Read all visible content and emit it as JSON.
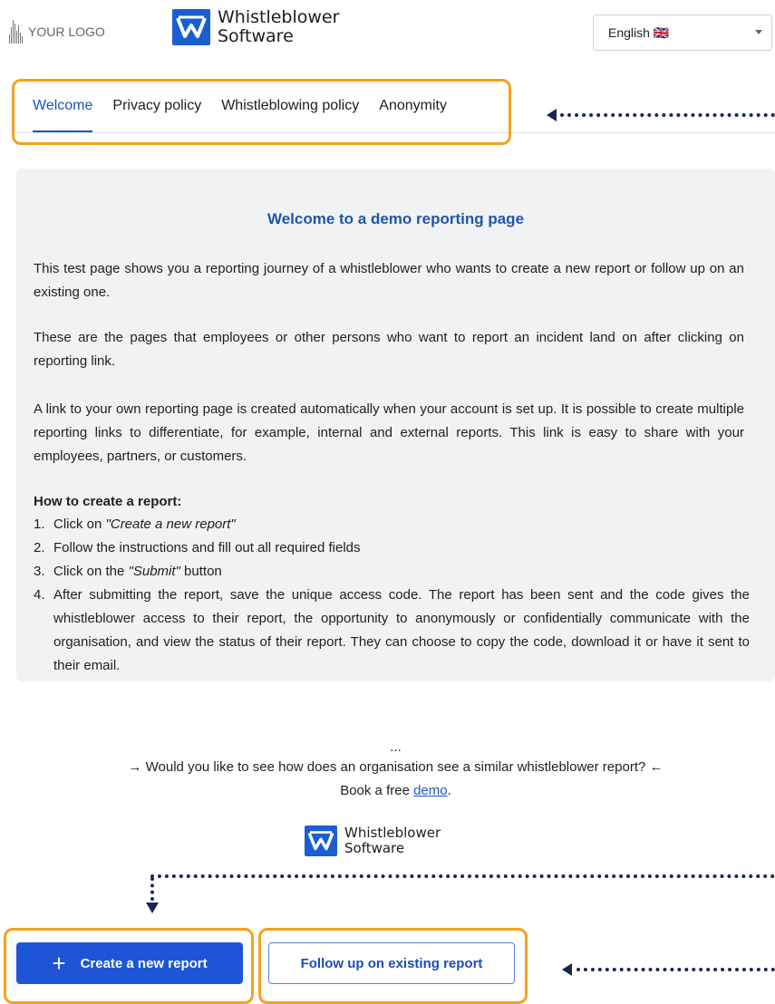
{
  "header": {
    "your_logo": "YOUR LOGO",
    "brand_line1": "Whistleblower",
    "brand_line2": "Software",
    "language": "English 🇬🇧"
  },
  "tabs": [
    {
      "label": "Welcome",
      "active": true
    },
    {
      "label": "Privacy policy"
    },
    {
      "label": "Whistleblowing policy"
    },
    {
      "label": "Anonymity"
    }
  ],
  "content": {
    "title": "Welcome to a demo reporting page",
    "paragraphs": [
      "This test page shows you a reporting journey of a whistleblower who wants to create a new report or follow up on an existing one.",
      "These are the pages that employees or other persons who want to report an incident land on after clicking on reporting link.",
      "A link to your own reporting page is created automatically when your account is set up. It is possible to create multiple reporting links to differentiate, for example, internal and external reports. This link is easy to share with your employees, partners, or customers."
    ],
    "howto_heading": "How to create a report:",
    "steps": [
      {
        "num": "1.",
        "pre": "Click on ",
        "em": "\"Create a new report\"",
        "post": ""
      },
      {
        "num": "2.",
        "pre": "Follow the instructions and fill out all required fields",
        "em": "",
        "post": ""
      },
      {
        "num": "3.",
        "pre": "Click on the ",
        "em": "\"Submit\"",
        "post": " button"
      },
      {
        "num": "4.",
        "pre": "After submitting the report, save the unique access code. The report has been sent and the code gives the whistleblower access to their report, the opportunity to anonymously or confidentially communicate with the organisation, and view the status of their report. They can choose to copy the code, download it or have it sent to their email.",
        "em": "",
        "post": ""
      }
    ],
    "ellipsis": "...",
    "question": "→ Would you like to see how does an organisation see a similar whistleblower report? ←",
    "book_prefix": "Book a free ",
    "book_link": "demo",
    "book_suffix": "."
  },
  "actions": {
    "create_label": "Create a new report",
    "create_icon": "+",
    "follow_label": "Follow up on existing report"
  },
  "colors": {
    "accent": "#1d55d6",
    "highlight": "#f4a21f",
    "pointer": "#17284f"
  }
}
